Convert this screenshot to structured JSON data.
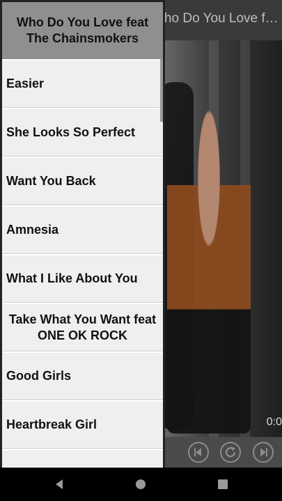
{
  "app": {
    "title": "Who Do You Love feat The Chainsmokers",
    "playback_time": "0:0"
  },
  "drawer": {
    "header": "Who Do You Love feat The Chainsmokers",
    "songs": [
      {
        "label": "Easier"
      },
      {
        "label": "She Looks So Perfect"
      },
      {
        "label": "Want You Back"
      },
      {
        "label": "Amnesia"
      },
      {
        "label": "What I Like About You"
      },
      {
        "label": "Take What You Want feat ONE OK ROCK"
      },
      {
        "label": "Good Girls"
      },
      {
        "label": "Heartbreak Girl"
      },
      {
        "label": ""
      }
    ]
  },
  "controls": {
    "prev_icon": "previous-icon",
    "replay_icon": "replay-icon",
    "next_icon": "next-icon"
  },
  "navbar": {
    "back_icon": "back-icon",
    "home_icon": "home-icon",
    "recents_icon": "recents-icon"
  }
}
